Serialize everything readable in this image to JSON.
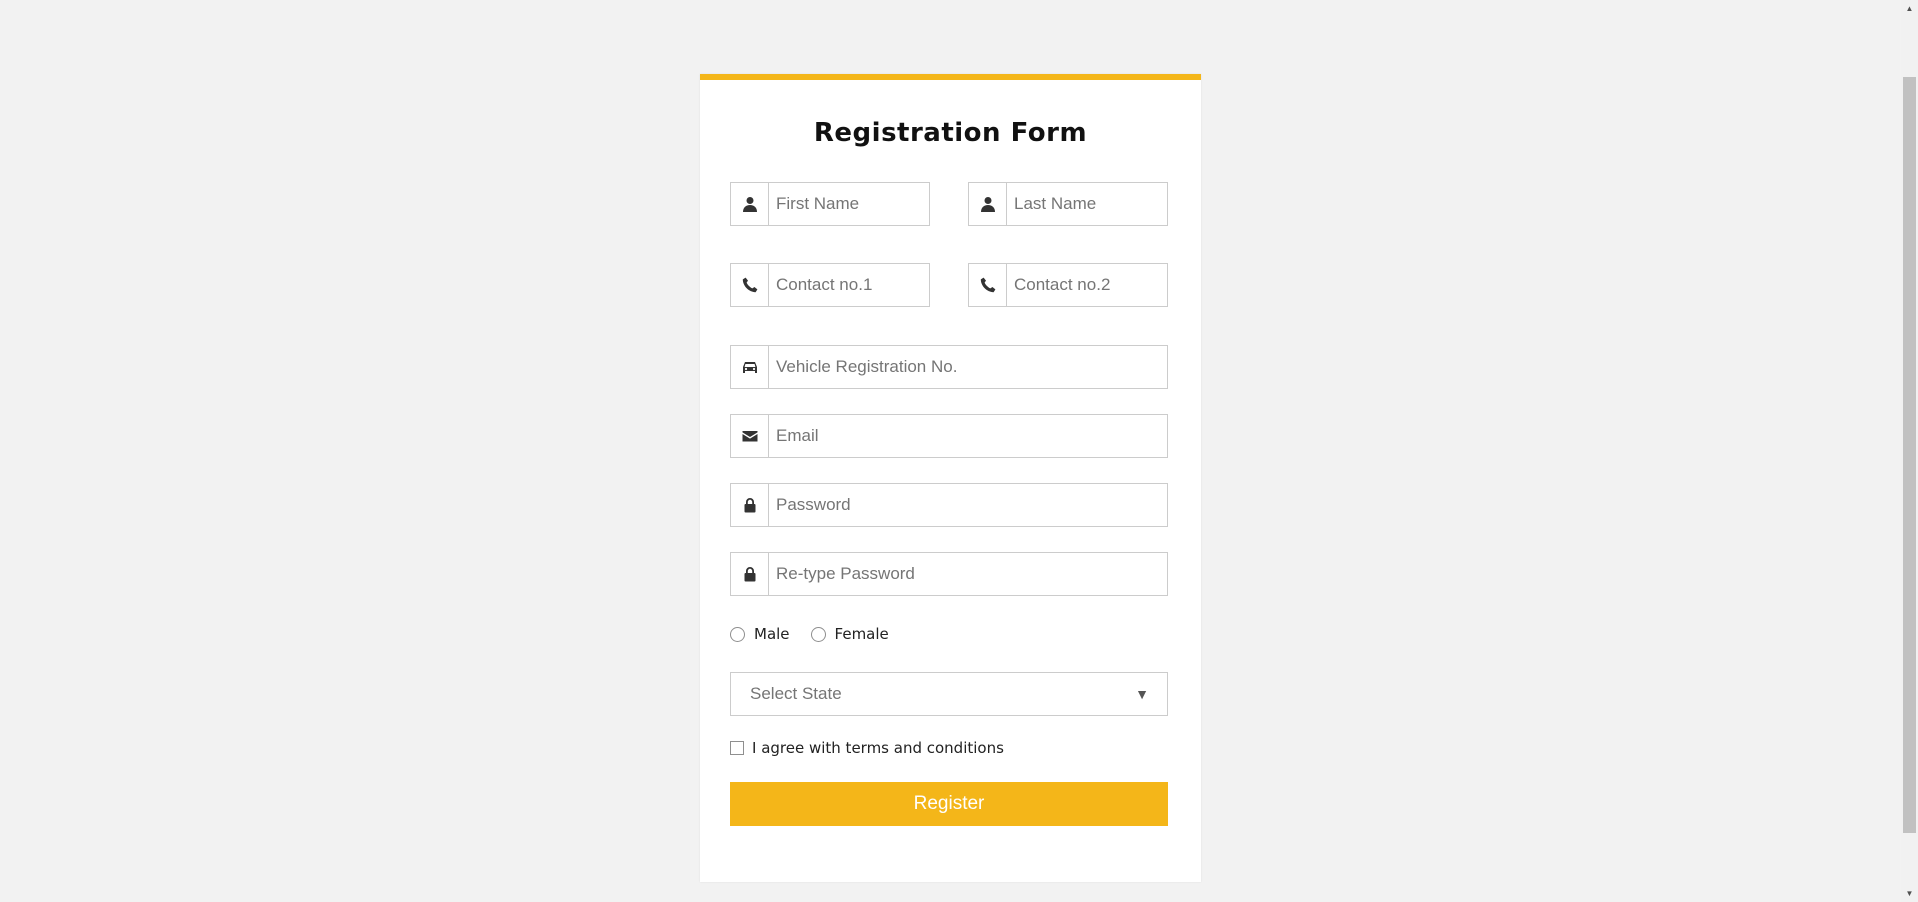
{
  "form": {
    "title": "Registration Form",
    "accent_color": "#f4b619",
    "fields": {
      "first_name": {
        "placeholder": "First Name",
        "icon": "user-icon"
      },
      "last_name": {
        "placeholder": "Last Name",
        "icon": "user-icon"
      },
      "contact1": {
        "placeholder": "Contact no.1",
        "icon": "phone-icon"
      },
      "contact2": {
        "placeholder": "Contact no.2",
        "icon": "phone-icon"
      },
      "vehicle": {
        "placeholder": "Vehicle Registration No.",
        "icon": "car-icon"
      },
      "email": {
        "placeholder": "Email",
        "icon": "envelope-icon"
      },
      "password": {
        "placeholder": "Password",
        "icon": "lock-icon"
      },
      "retype_password": {
        "placeholder": "Re-type Password",
        "icon": "lock-icon"
      }
    },
    "gender": {
      "male_label": "Male",
      "female_label": "Female"
    },
    "state_select": {
      "selected": "Select State"
    },
    "agree_label": "I agree with terms and conditions",
    "register_label": "Register"
  }
}
